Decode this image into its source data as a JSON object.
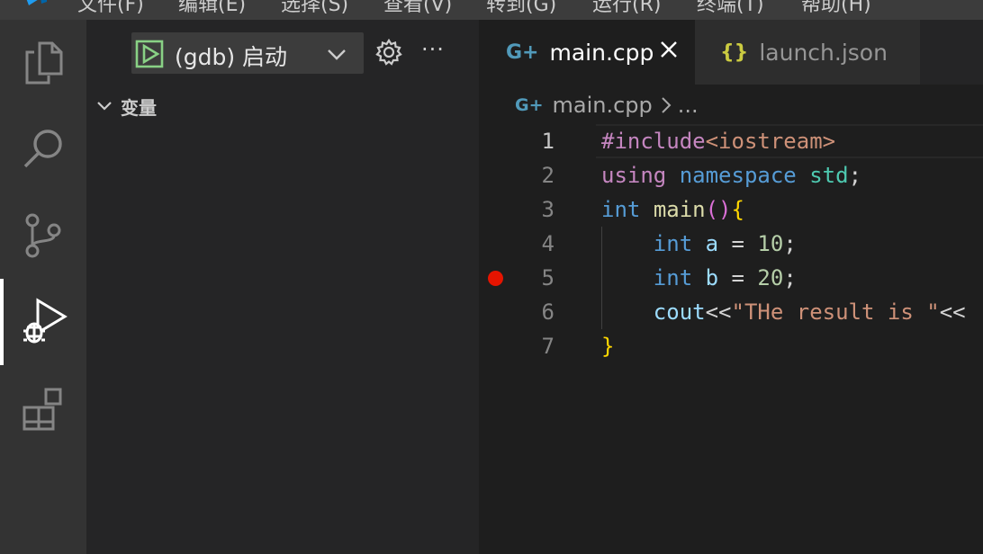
{
  "menubar": {
    "items": [
      "文件(F)",
      "编辑(E)",
      "选择(S)",
      "查看(V)",
      "转到(G)",
      "运行(R)",
      "终端(T)",
      "帮助(H)"
    ]
  },
  "activity_bar": {
    "items": [
      {
        "name": "explorer",
        "icon": "files-icon"
      },
      {
        "name": "search",
        "icon": "search-icon"
      },
      {
        "name": "source-control",
        "icon": "source-control-icon"
      },
      {
        "name": "run-and-debug",
        "icon": "run-debug-icon",
        "active": true
      },
      {
        "name": "extensions",
        "icon": "extensions-icon"
      }
    ]
  },
  "sidebar": {
    "debug_config": "(gdb) 启动",
    "more_label": "···",
    "variables_header": "变量"
  },
  "editor": {
    "tabs": [
      {
        "icon": "G+",
        "label": "main.cpp",
        "active": true,
        "close": "×"
      },
      {
        "icon": "{}",
        "label": "launch.json",
        "active": false
      }
    ],
    "breadcrumb": {
      "icon": "G+",
      "file": "main.cpp",
      "separator": ">",
      "rest": "..."
    },
    "lines": [
      {
        "num": "1",
        "current": true,
        "breakpoint": false
      },
      {
        "num": "2",
        "current": false,
        "breakpoint": false
      },
      {
        "num": "3",
        "current": false,
        "breakpoint": false
      },
      {
        "num": "4",
        "current": false,
        "breakpoint": false
      },
      {
        "num": "5",
        "current": false,
        "breakpoint": true
      },
      {
        "num": "6",
        "current": false,
        "breakpoint": false
      },
      {
        "num": "7",
        "current": false,
        "breakpoint": false
      }
    ],
    "code": {
      "l1": {
        "directive": "#include",
        "header": "<iostream>"
      },
      "l2": {
        "using": "using",
        "namespace": "namespace",
        "std": "std",
        "semi": ";"
      },
      "l3": {
        "type": "int",
        "fn": "main",
        "parens": "()",
        "brace": "{"
      },
      "l4": {
        "indent": "    ",
        "type": "int",
        "var": "a",
        "op": " = ",
        "num": "10",
        "semi": ";"
      },
      "l5": {
        "indent": "    ",
        "type": "int",
        "var": "b",
        "op": " = ",
        "num": "20",
        "semi": ";"
      },
      "l6": {
        "indent": "    ",
        "var": "cout",
        "op": "<<",
        "str": "\"THe result is \"",
        "tail": "<<"
      },
      "l7": {
        "brace": "}"
      }
    }
  },
  "colors": {
    "accent_green": "#89d185",
    "breakpoint": "#e51400",
    "cpp_icon": "#519aba",
    "json_icon": "#cbcb41"
  }
}
